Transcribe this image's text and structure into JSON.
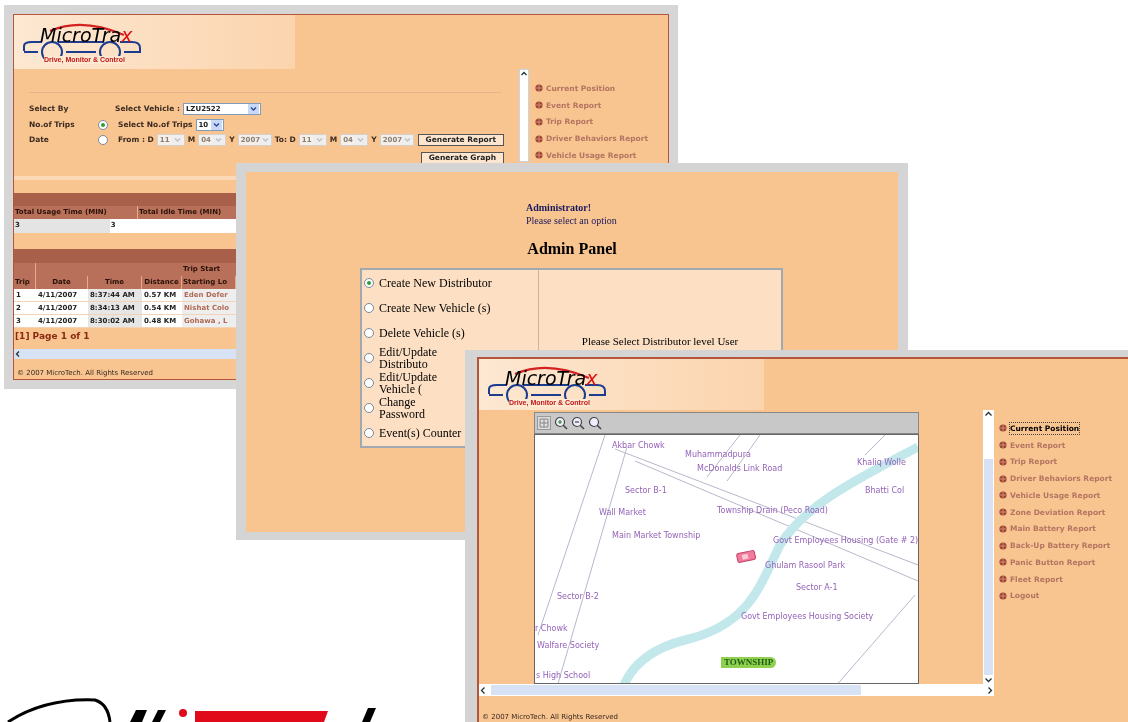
{
  "report_window": {
    "logo": {
      "name": "MicroTra",
      "accent": "x",
      "tagline": "Drive, Monitor & Control"
    },
    "form": {
      "select_by_label": "Select By",
      "vehicle_label": "Select Vehicle :",
      "vehicle_value": "LZU2522",
      "modes": [
        {
          "label": "No.of Trips",
          "selected": true,
          "parts": [
            {
              "kind": "label",
              "text": "Select No.of Trips"
            },
            {
              "kind": "select",
              "text": "10",
              "disabled": false
            }
          ]
        },
        {
          "label": "Date",
          "selected": false,
          "parts": [
            {
              "kind": "label",
              "text": "From : D"
            },
            {
              "kind": "select",
              "text": "11",
              "disabled": true
            },
            {
              "kind": "label",
              "text": "M"
            },
            {
              "kind": "select",
              "text": "04",
              "disabled": true
            },
            {
              "kind": "label",
              "text": "Y"
            },
            {
              "kind": "select",
              "text": "2007",
              "disabled": true
            },
            {
              "kind": "label",
              "text": "To: D"
            },
            {
              "kind": "select",
              "text": "11",
              "disabled": true
            },
            {
              "kind": "label",
              "text": "M"
            },
            {
              "kind": "select",
              "text": "04",
              "disabled": true
            },
            {
              "kind": "label",
              "text": "Y"
            },
            {
              "kind": "select",
              "text": "2007",
              "disabled": true
            }
          ]
        }
      ],
      "buttons": [
        "Generate Report",
        "Generate Graph"
      ]
    },
    "menu": [
      "Current Position",
      "Event Report",
      "Trip Report",
      "Driver Behaviors Report",
      "Vehicle Usage Report"
    ],
    "usage_table": {
      "columns": [
        "Total Usage Time (MIN)",
        "Total Idle Time (MIN)"
      ],
      "rows": [
        [
          "3",
          "3"
        ]
      ]
    },
    "trips_table": {
      "group_header": "Trip Start",
      "columns": [
        "Trip",
        "Date",
        "Time",
        "Distance",
        "Starting Lo"
      ],
      "rows": [
        [
          "1",
          "4/11/2007",
          "8:37:44 AM",
          "0.57 KM",
          "Eden Defer"
        ],
        [
          "2",
          "4/11/2007",
          "8:34:13 AM",
          "0.54 KM",
          "Nishat Colo"
        ],
        [
          "3",
          "4/11/2007",
          "8:30:02 AM",
          "0.48 KM",
          "Gohawa , L"
        ]
      ]
    },
    "pager": "[1] Page 1 of 1",
    "footer": "© 2007 MicroTech. All Rights Reserved"
  },
  "admin_window": {
    "greeting": "Administrator!",
    "prompt": "Please select an option",
    "title": "Admin Panel",
    "options": [
      {
        "label": "Create New Distributor",
        "selected": true
      },
      {
        "label": "Create New Vehicle (s)",
        "selected": false
      },
      {
        "label": "Delete Vehicle (s)",
        "selected": false
      },
      {
        "label": "Edit/Update Distributo",
        "selected": false
      },
      {
        "label": "Edit/Update Vehicle (",
        "selected": false
      },
      {
        "label": "Change Password",
        "selected": false
      },
      {
        "label": "Event(s) Counter",
        "selected": false
      }
    ],
    "message": "Please Select Distributor level User"
  },
  "map_window": {
    "logo": {
      "name": "MicroTra",
      "accent": "x",
      "tagline": "Drive, Monitor & Control"
    },
    "map_labels": [
      {
        "text": "Akbar Chowk",
        "kind": "place"
      },
      {
        "text": "Muhammadpura",
        "kind": "place"
      },
      {
        "text": "McDonalds Link Road",
        "kind": "place"
      },
      {
        "text": "Khaliq Wolle",
        "kind": "place"
      },
      {
        "text": "Bhatti Col",
        "kind": "place"
      },
      {
        "text": "Sector B-1",
        "kind": "place"
      },
      {
        "text": "Wall Market",
        "kind": "place"
      },
      {
        "text": "Township Drain (Peco Road)",
        "kind": "place"
      },
      {
        "text": "Main Market Township",
        "kind": "place"
      },
      {
        "text": "Govt Employees Housing (Gate # 2)",
        "kind": "place"
      },
      {
        "text": "Ghulam Rasool Park",
        "kind": "place"
      },
      {
        "text": "Sector A-1",
        "kind": "place"
      },
      {
        "text": "Sector B-2",
        "kind": "place"
      },
      {
        "text": "r Chowk",
        "kind": "place"
      },
      {
        "text": "Govt Employees Housing Society",
        "kind": "place"
      },
      {
        "text": "Walfare Society",
        "kind": "place"
      },
      {
        "text": "TOWNSHIP",
        "kind": "area"
      },
      {
        "text": "s High School",
        "kind": "place"
      }
    ],
    "menu": [
      {
        "label": "Current Position",
        "selected": true
      },
      {
        "label": "Event Report",
        "selected": false
      },
      {
        "label": "Trip Report",
        "selected": false
      },
      {
        "label": "Driver Behaviors Report",
        "selected": false
      },
      {
        "label": "Vehicle Usage Report",
        "selected": false
      },
      {
        "label": "Zone Deviation Report",
        "selected": false
      },
      {
        "label": "Main Battery Report",
        "selected": false
      },
      {
        "label": "Back-Up Battery Report",
        "selected": false
      },
      {
        "label": "Panic Button Report",
        "selected": false
      },
      {
        "label": "Fleet Report",
        "selected": false
      },
      {
        "label": "Logout",
        "selected": false
      }
    ],
    "footer": "© 2007 MicroTech. All Rights Reserved"
  }
}
